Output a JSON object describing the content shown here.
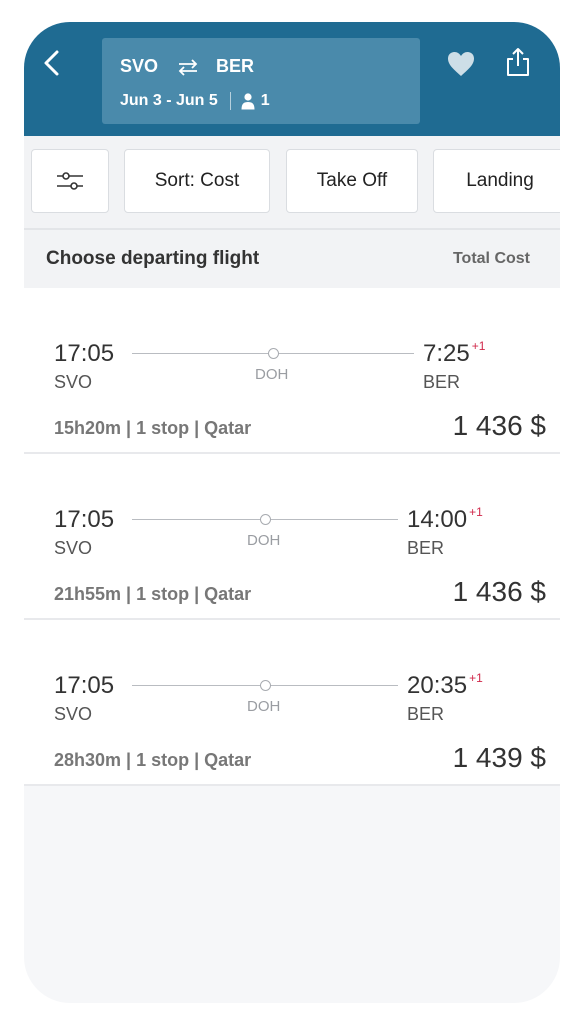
{
  "header": {
    "origin": "SVO",
    "destination": "BER",
    "dates": "Jun 3 - Jun 5",
    "passengers": "1",
    "back_icon": "chevron-left-icon",
    "favorite_icon": "heart-icon",
    "share_icon": "share-icon",
    "swap_icon": "swap-arrows-icon",
    "person_icon": "person-icon"
  },
  "filters": {
    "filter_icon": "sliders-icon",
    "sort_label": "Sort: Cost",
    "takeoff_label": "Take Off",
    "landing_label": "Landing"
  },
  "list": {
    "title": "Choose departing flight",
    "total_label": "Total Cost"
  },
  "flights": [
    {
      "dep_time": "17:05",
      "dep_code": "SVO",
      "stop_code": "DOH",
      "arr_time": "7:25",
      "arr_offset": "+1",
      "arr_code": "BER",
      "summary": "15h20m | 1 stop | Qatar",
      "price": "1 436 $"
    },
    {
      "dep_time": "17:05",
      "dep_code": "SVO",
      "stop_code": "DOH",
      "arr_time": "14:00",
      "arr_offset": "+1",
      "arr_code": "BER",
      "summary": "21h55m | 1 stop | Qatar",
      "price": "1 436 $"
    },
    {
      "dep_time": "17:05",
      "dep_code": "SVO",
      "stop_code": "DOH",
      "arr_time": "20:35",
      "arr_offset": "+1",
      "arr_code": "BER",
      "summary": "28h30m | 1 stop | Qatar",
      "price": "1 439 $"
    }
  ],
  "colors": {
    "header_bg": "#1f6b92",
    "route_box_bg": "#4a8aab",
    "day_offset": "#d0284a"
  }
}
